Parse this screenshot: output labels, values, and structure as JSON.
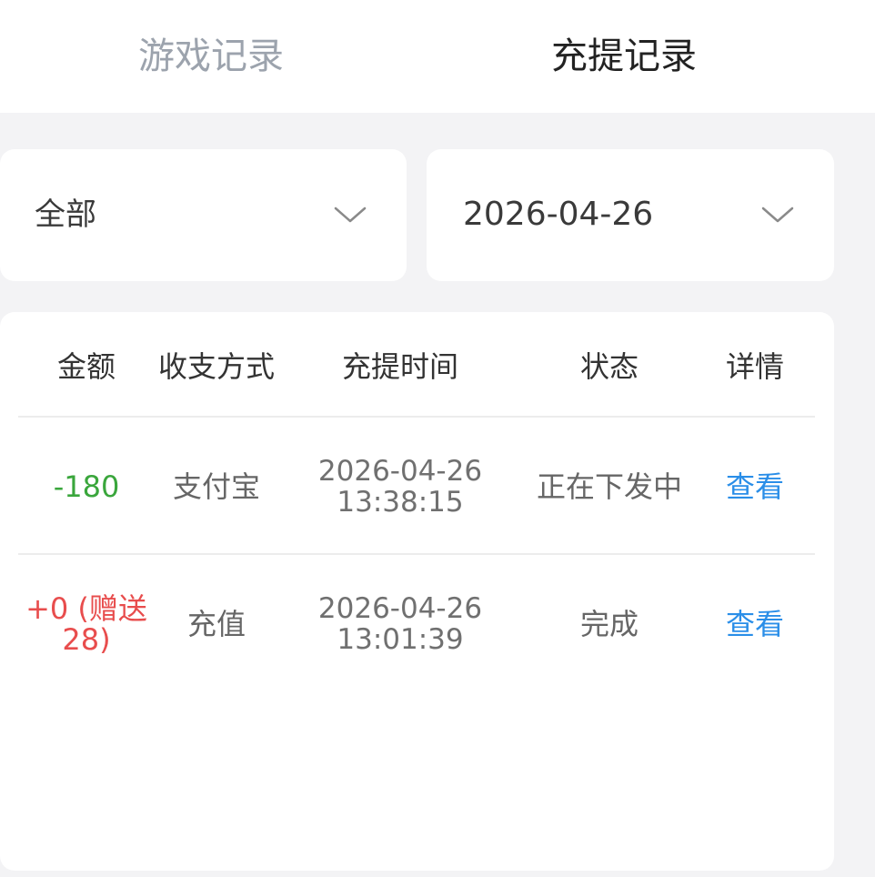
{
  "tabs": [
    {
      "label": "游戏记录",
      "active": false
    },
    {
      "label": "充提记录",
      "active": true
    }
  ],
  "filters": {
    "type_value": "全部",
    "date_value": "2026-04-26"
  },
  "table": {
    "headers": [
      "金额",
      "收支方式",
      "充提时间",
      "状态",
      "详情"
    ],
    "rows": [
      {
        "amount": "-180",
        "method": "支付宝",
        "date": "2026-04-26",
        "time": "13:38:15",
        "status": "正在下发中",
        "detail": "查看"
      },
      {
        "amount_line1": "+0 (赠送",
        "amount_line2": "28)",
        "method": "充值",
        "date": "2026-04-26",
        "time": "13:01:39",
        "status": "完成",
        "detail": "查看"
      }
    ]
  },
  "colors": {
    "negative": "#3aa63c",
    "positive": "#e84d4d",
    "link": "#2a8ee8"
  }
}
